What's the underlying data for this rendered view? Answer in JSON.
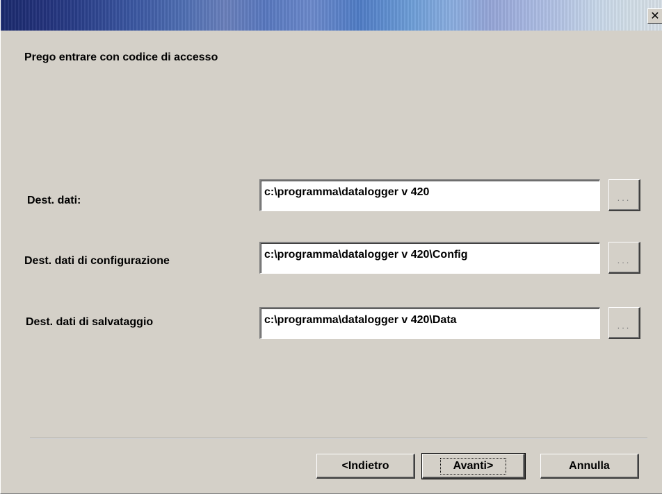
{
  "window": {
    "close_glyph": "✕",
    "close_icon": "close-icon"
  },
  "heading": "Prego entrare con codice di accesso",
  "fields": [
    {
      "label": "Dest.  dati:",
      "value": "c:\\programma\\datalogger v 420",
      "browse_label": "..."
    },
    {
      "label": "Dest. dati di configurazione",
      "value": "c:\\programma\\datalogger v 420\\Config",
      "browse_label": "..."
    },
    {
      "label": "Dest. dati di salvataggio",
      "value": "c:\\programma\\datalogger v 420\\Data",
      "browse_label": "..."
    }
  ],
  "buttons": {
    "back": "<Indietro",
    "next": "Avanti>",
    "cancel": "Annulla"
  }
}
